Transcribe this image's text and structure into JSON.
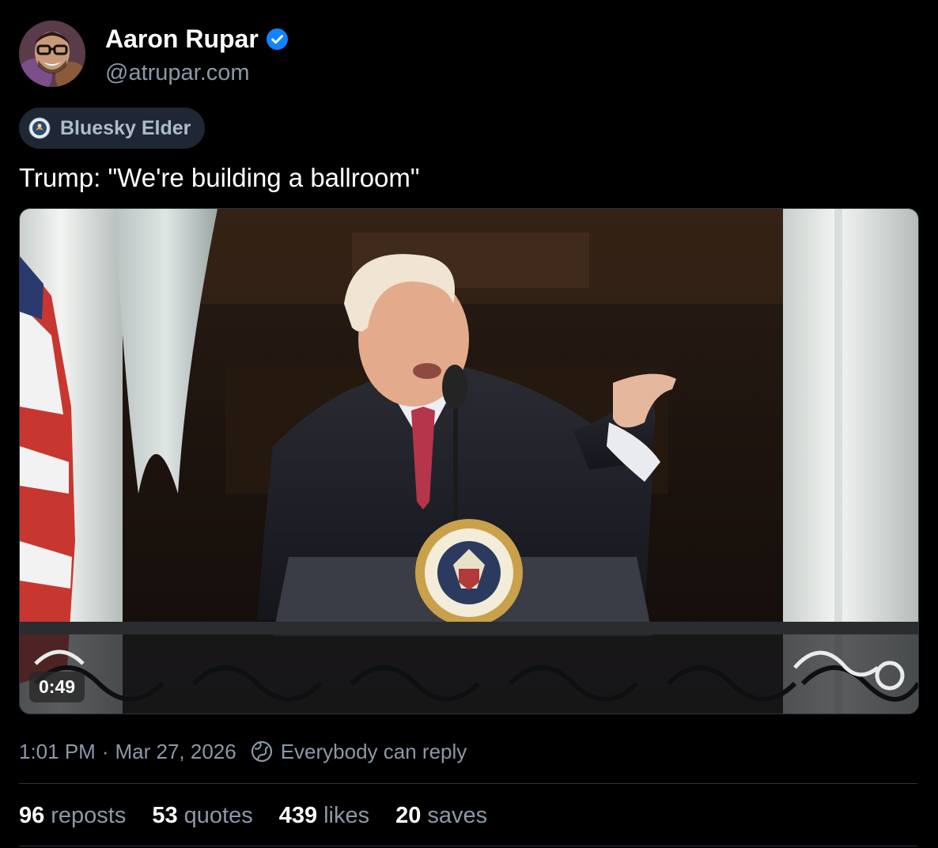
{
  "author": {
    "display_name": "Aaron Rupar",
    "handle": "@atrupar.com",
    "verified_icon": "verified-check-icon",
    "avatar_icon": "avatar-photo"
  },
  "badge": {
    "label": "Bluesky Elder",
    "icon": "elder-badge-icon"
  },
  "post": {
    "text": "Trump: \"We're building a ballroom\""
  },
  "media": {
    "type": "video",
    "duration": "0:49"
  },
  "meta": {
    "time": "1:01 PM",
    "separator": "·",
    "date": "Mar 27, 2026",
    "reply_setting": "Everybody can reply",
    "reply_icon": "reply-settings-icon"
  },
  "stats": [
    {
      "count": "96",
      "label": "reposts"
    },
    {
      "count": "53",
      "label": "quotes"
    },
    {
      "count": "439",
      "label": "likes"
    },
    {
      "count": "20",
      "label": "saves"
    }
  ],
  "colors": {
    "background": "#000000",
    "muted_text": "#8b98a8",
    "verified_blue": "#1083fe",
    "divider": "#2a3340",
    "badge_bg": "#1e2733"
  }
}
